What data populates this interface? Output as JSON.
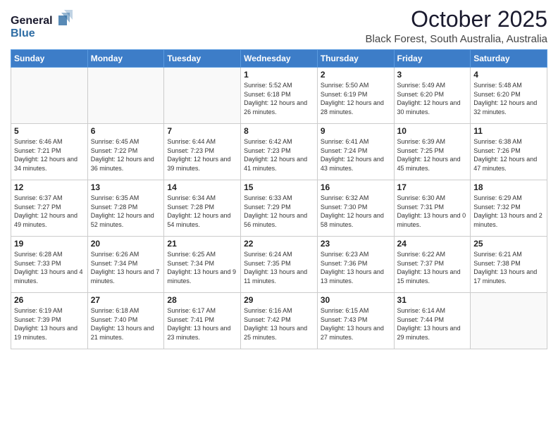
{
  "header": {
    "logo_line1": "General",
    "logo_line2": "Blue",
    "month": "October 2025",
    "location": "Black Forest, South Australia, Australia"
  },
  "days_of_week": [
    "Sunday",
    "Monday",
    "Tuesday",
    "Wednesday",
    "Thursday",
    "Friday",
    "Saturday"
  ],
  "weeks": [
    [
      {
        "day": "",
        "info": ""
      },
      {
        "day": "",
        "info": ""
      },
      {
        "day": "",
        "info": ""
      },
      {
        "day": "1",
        "info": "Sunrise: 5:52 AM\nSunset: 6:18 PM\nDaylight: 12 hours\nand 26 minutes."
      },
      {
        "day": "2",
        "info": "Sunrise: 5:50 AM\nSunset: 6:19 PM\nDaylight: 12 hours\nand 28 minutes."
      },
      {
        "day": "3",
        "info": "Sunrise: 5:49 AM\nSunset: 6:20 PM\nDaylight: 12 hours\nand 30 minutes."
      },
      {
        "day": "4",
        "info": "Sunrise: 5:48 AM\nSunset: 6:20 PM\nDaylight: 12 hours\nand 32 minutes."
      }
    ],
    [
      {
        "day": "5",
        "info": "Sunrise: 6:46 AM\nSunset: 7:21 PM\nDaylight: 12 hours\nand 34 minutes."
      },
      {
        "day": "6",
        "info": "Sunrise: 6:45 AM\nSunset: 7:22 PM\nDaylight: 12 hours\nand 36 minutes."
      },
      {
        "day": "7",
        "info": "Sunrise: 6:44 AM\nSunset: 7:23 PM\nDaylight: 12 hours\nand 39 minutes."
      },
      {
        "day": "8",
        "info": "Sunrise: 6:42 AM\nSunset: 7:23 PM\nDaylight: 12 hours\nand 41 minutes."
      },
      {
        "day": "9",
        "info": "Sunrise: 6:41 AM\nSunset: 7:24 PM\nDaylight: 12 hours\nand 43 minutes."
      },
      {
        "day": "10",
        "info": "Sunrise: 6:39 AM\nSunset: 7:25 PM\nDaylight: 12 hours\nand 45 minutes."
      },
      {
        "day": "11",
        "info": "Sunrise: 6:38 AM\nSunset: 7:26 PM\nDaylight: 12 hours\nand 47 minutes."
      }
    ],
    [
      {
        "day": "12",
        "info": "Sunrise: 6:37 AM\nSunset: 7:27 PM\nDaylight: 12 hours\nand 49 minutes."
      },
      {
        "day": "13",
        "info": "Sunrise: 6:35 AM\nSunset: 7:28 PM\nDaylight: 12 hours\nand 52 minutes."
      },
      {
        "day": "14",
        "info": "Sunrise: 6:34 AM\nSunset: 7:28 PM\nDaylight: 12 hours\nand 54 minutes."
      },
      {
        "day": "15",
        "info": "Sunrise: 6:33 AM\nSunset: 7:29 PM\nDaylight: 12 hours\nand 56 minutes."
      },
      {
        "day": "16",
        "info": "Sunrise: 6:32 AM\nSunset: 7:30 PM\nDaylight: 12 hours\nand 58 minutes."
      },
      {
        "day": "17",
        "info": "Sunrise: 6:30 AM\nSunset: 7:31 PM\nDaylight: 13 hours\nand 0 minutes."
      },
      {
        "day": "18",
        "info": "Sunrise: 6:29 AM\nSunset: 7:32 PM\nDaylight: 13 hours\nand 2 minutes."
      }
    ],
    [
      {
        "day": "19",
        "info": "Sunrise: 6:28 AM\nSunset: 7:33 PM\nDaylight: 13 hours\nand 4 minutes."
      },
      {
        "day": "20",
        "info": "Sunrise: 6:26 AM\nSunset: 7:34 PM\nDaylight: 13 hours\nand 7 minutes."
      },
      {
        "day": "21",
        "info": "Sunrise: 6:25 AM\nSunset: 7:34 PM\nDaylight: 13 hours\nand 9 minutes."
      },
      {
        "day": "22",
        "info": "Sunrise: 6:24 AM\nSunset: 7:35 PM\nDaylight: 13 hours\nand 11 minutes."
      },
      {
        "day": "23",
        "info": "Sunrise: 6:23 AM\nSunset: 7:36 PM\nDaylight: 13 hours\nand 13 minutes."
      },
      {
        "day": "24",
        "info": "Sunrise: 6:22 AM\nSunset: 7:37 PM\nDaylight: 13 hours\nand 15 minutes."
      },
      {
        "day": "25",
        "info": "Sunrise: 6:21 AM\nSunset: 7:38 PM\nDaylight: 13 hours\nand 17 minutes."
      }
    ],
    [
      {
        "day": "26",
        "info": "Sunrise: 6:19 AM\nSunset: 7:39 PM\nDaylight: 13 hours\nand 19 minutes."
      },
      {
        "day": "27",
        "info": "Sunrise: 6:18 AM\nSunset: 7:40 PM\nDaylight: 13 hours\nand 21 minutes."
      },
      {
        "day": "28",
        "info": "Sunrise: 6:17 AM\nSunset: 7:41 PM\nDaylight: 13 hours\nand 23 minutes."
      },
      {
        "day": "29",
        "info": "Sunrise: 6:16 AM\nSunset: 7:42 PM\nDaylight: 13 hours\nand 25 minutes."
      },
      {
        "day": "30",
        "info": "Sunrise: 6:15 AM\nSunset: 7:43 PM\nDaylight: 13 hours\nand 27 minutes."
      },
      {
        "day": "31",
        "info": "Sunrise: 6:14 AM\nSunset: 7:44 PM\nDaylight: 13 hours\nand 29 minutes."
      },
      {
        "day": "",
        "info": ""
      }
    ]
  ]
}
